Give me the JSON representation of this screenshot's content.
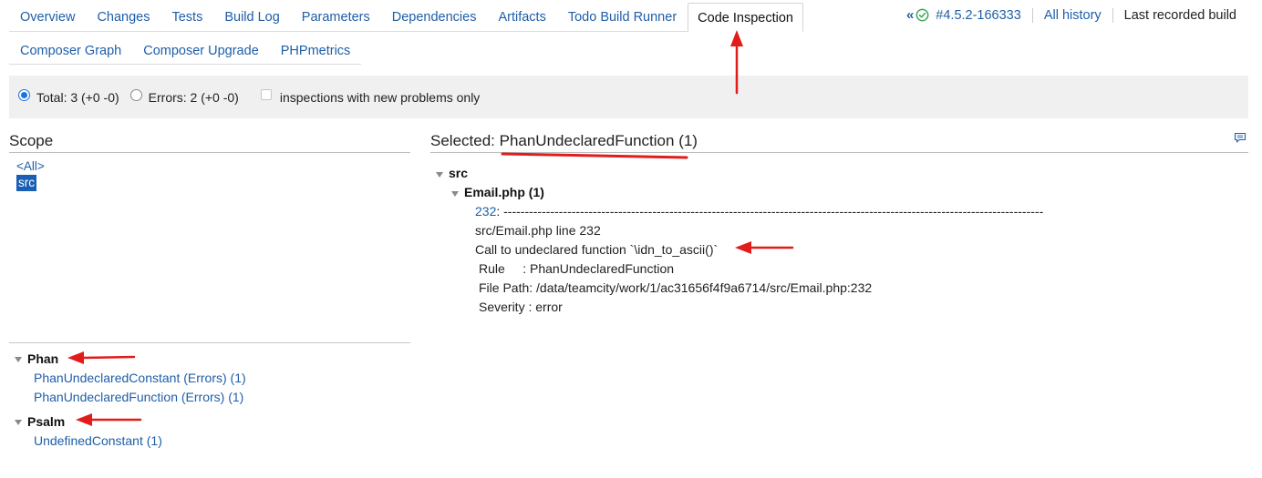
{
  "tabs_row1": [
    {
      "label": "Overview"
    },
    {
      "label": "Changes"
    },
    {
      "label": "Tests"
    },
    {
      "label": "Build Log"
    },
    {
      "label": "Parameters"
    },
    {
      "label": "Dependencies"
    },
    {
      "label": "Artifacts"
    },
    {
      "label": "Todo Build Runner"
    },
    {
      "label": "Code Inspection",
      "active": true
    }
  ],
  "tabs_row2": [
    {
      "label": "Composer Graph"
    },
    {
      "label": "Composer Upgrade"
    },
    {
      "label": "PHPmetrics"
    }
  ],
  "build": {
    "number": "#4.5.2-166333",
    "all_history": "All history",
    "last_recorded": "Last recorded build",
    "icons": [
      "double-chevron-left-icon",
      "check-circle-icon"
    ]
  },
  "filter": {
    "total_label": "Total: 3 (+0 -0)",
    "errors_label": "Errors: 2 (+0 -0)",
    "new_only_label": "inspections with new problems only",
    "selected": "total"
  },
  "scope": {
    "title": "Scope",
    "items": [
      {
        "label": "<All>"
      },
      {
        "label": "src",
        "selected": true
      }
    ]
  },
  "inspections": {
    "groups": [
      {
        "name": "Phan",
        "items": [
          "PhanUndeclaredConstant (Errors) (1)",
          "PhanUndeclaredFunction (Errors) (1)"
        ]
      },
      {
        "name": "Psalm",
        "items": [
          "UndefinedConstant (1)"
        ]
      }
    ]
  },
  "selected": {
    "prefix": "Selected: ",
    "name": "PhanUndeclaredFunction",
    "count": " (1)",
    "folder": "src",
    "file": "Email.php (1)",
    "line_number": "232",
    "line_rest": ":  -------------------------------------------------------------------------------------------------------------------------------",
    "location": "src/Email.php line 232",
    "message": "Call to undeclared function `\\idn_to_ascii()`",
    "rule": "Rule     : PhanUndeclaredFunction",
    "file_path": "File Path: /data/teamcity/work/1/ac31656f4f9a6714/src/Email.php:232",
    "severity": "Severity : error"
  },
  "colors": {
    "link": "#1f5ea8",
    "annotation_red": "#e21b1b",
    "selection": "#1a5fb4",
    "success": "#3aa856"
  }
}
